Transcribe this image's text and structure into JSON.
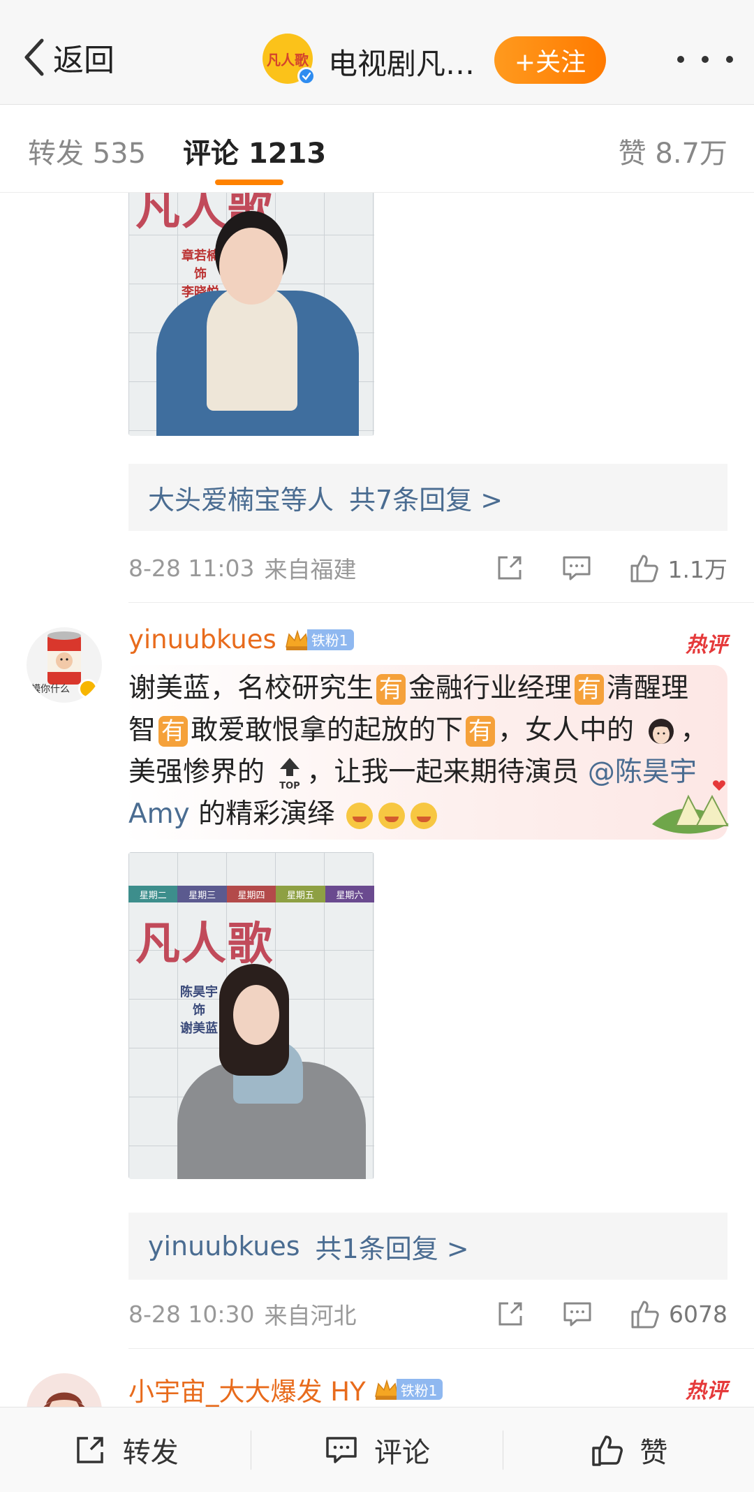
{
  "nav": {
    "back_label": "返回",
    "account_name": "电视剧凡…",
    "avatar_glyph": "凡人歌",
    "follow_label": "+关注"
  },
  "tabs": {
    "repost": "转发 535",
    "comment": "评论 1213",
    "like": "赞 8.7万",
    "accent": "#ff8200"
  },
  "feed": {
    "first": {
      "poster": {
        "title": "凡人歌",
        "credit": [
          "章若楠",
          "饰",
          "李晓悦"
        ]
      },
      "replies": {
        "names": "大头爱楠宝等人",
        "count": "共7条回复 >"
      },
      "meta": {
        "time": "8-28 11:03",
        "location": "来自福建",
        "likes": "1.1万"
      }
    },
    "second": {
      "username": "yinuubkues",
      "fan_label": "铁粉1",
      "hot": "热评",
      "avatar_caption": "蟆你什么",
      "text": {
        "p1": "谢美蓝，名校研究生",
        "you": "有",
        "p2": "金融行业经理",
        "p3": "清醒理智",
        "p4": "敢爱敢恨拿的起放的下",
        "p5": "，女人中的",
        "p6": "，美强惨界的",
        "p7": "，让我一起来期待演员",
        "mention": "@陈昊宇 Amy",
        "p8": " 的精彩演绎",
        "top_label": "TOP"
      },
      "poster": {
        "title": "凡人歌",
        "credit": [
          "陈昊宇",
          "饰",
          "谢美蓝"
        ],
        "days": [
          "星期二",
          "星期三",
          "星期四",
          "星期五",
          "星期六"
        ],
        "day_colors": [
          "#3d8e8c",
          "#5b5a8f",
          "#b34a4a",
          "#8ea043",
          "#6a4a8f"
        ]
      },
      "replies": {
        "names": "yinuubkues",
        "count": "共1条回复 >"
      },
      "meta": {
        "time": "8-28 10:30",
        "location": "来自河北",
        "likes": "6078"
      }
    },
    "third": {
      "username": "小宇宙_大大爆发 HY",
      "fan_label": "铁粉1",
      "hot": "热评"
    }
  },
  "bottom": {
    "repost": "转发",
    "comment": "评论",
    "like": "赞"
  }
}
